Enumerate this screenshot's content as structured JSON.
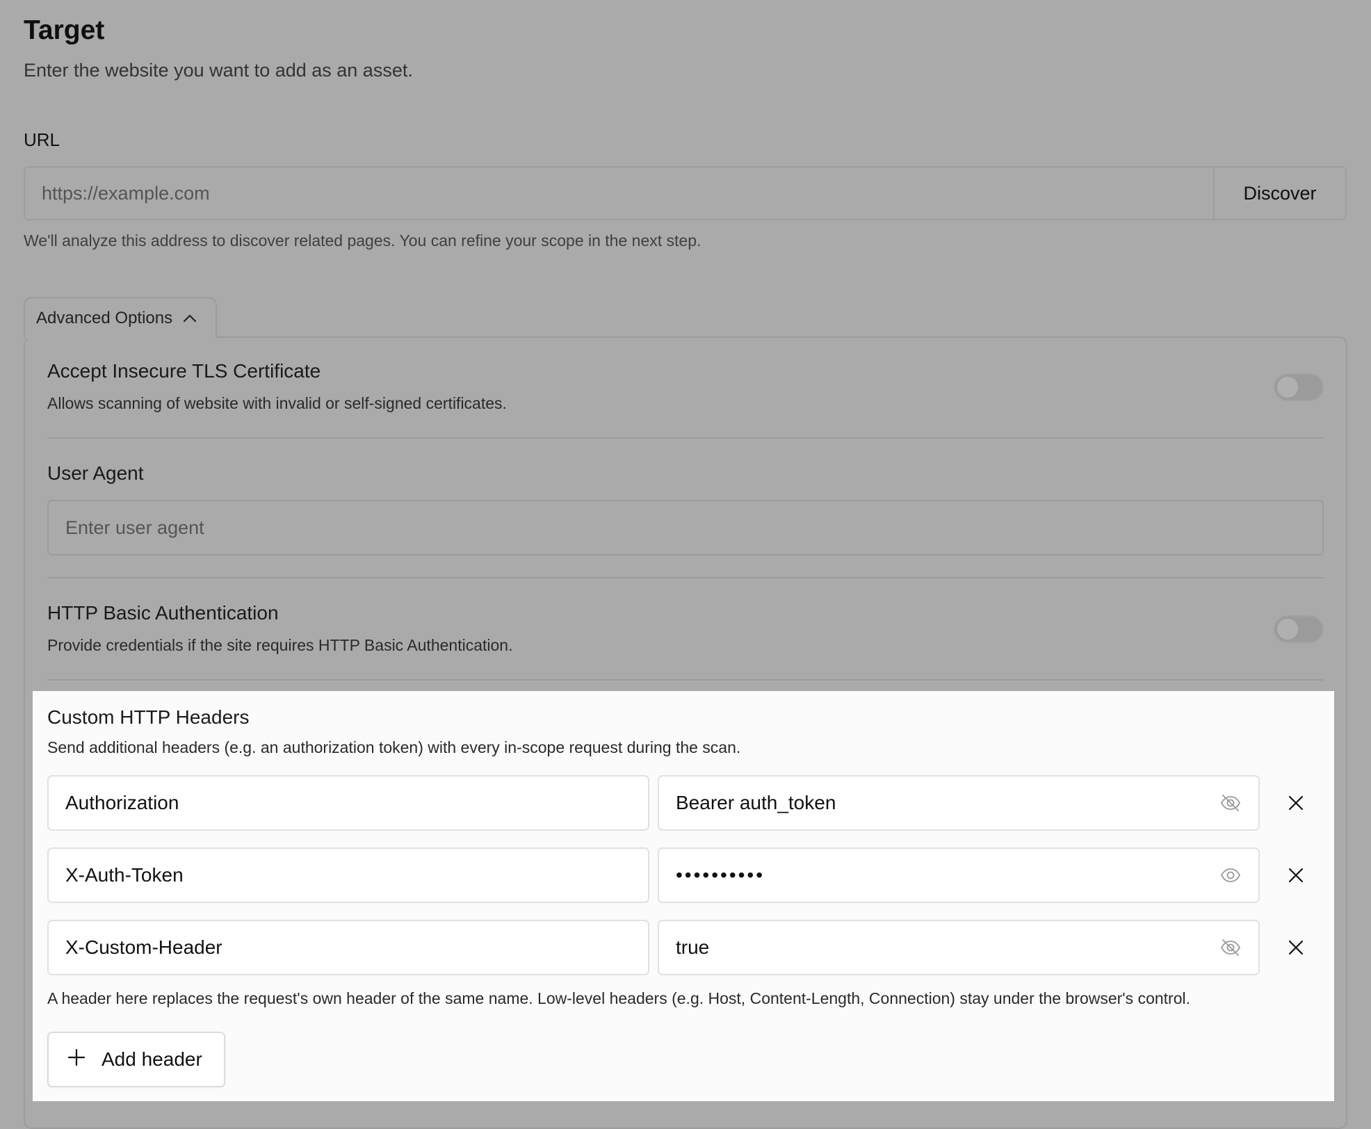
{
  "target": {
    "title": "Target",
    "subtitle": "Enter the website you want to add as an asset."
  },
  "url": {
    "label": "URL",
    "placeholder": "https://example.com",
    "value": "",
    "discover_label": "Discover",
    "help": "We'll analyze this address to discover related pages. You can refine your scope in the next step."
  },
  "advanced": {
    "toggle_label": "Advanced Options",
    "expanded": true,
    "tls": {
      "title": "Accept Insecure TLS Certificate",
      "description": "Allows scanning of website with invalid or self-signed certificates.",
      "enabled": false
    },
    "user_agent": {
      "title": "User Agent",
      "placeholder": "Enter user agent",
      "value": ""
    },
    "basic_auth": {
      "title": "HTTP Basic Authentication",
      "description": "Provide credentials if the site requires HTTP Basic Authentication.",
      "enabled": false
    },
    "custom_headers": {
      "title": "Custom HTTP Headers",
      "description": "Send additional headers (e.g. an authorization token) with every in-scope request during the scan.",
      "rows": [
        {
          "name": "Authorization",
          "value": "Bearer auth_token",
          "masked": false,
          "eye_icon": "eye-off-icon"
        },
        {
          "name": "X-Auth-Token",
          "value": "••••••••••",
          "masked": true,
          "eye_icon": "eye-icon"
        },
        {
          "name": "X-Custom-Header",
          "value": "true",
          "masked": false,
          "eye_icon": "eye-off-icon"
        }
      ],
      "note": "A header here replaces the request's own header of the same name. Low-level headers (e.g. Host, Content-Length, Connection) stay under the browser's control.",
      "add_label": "Add header"
    }
  },
  "colors": {
    "overlay_background": "#aaaaaa",
    "card_background": "#fbfbfb",
    "field_border": "#e1e1e1"
  }
}
